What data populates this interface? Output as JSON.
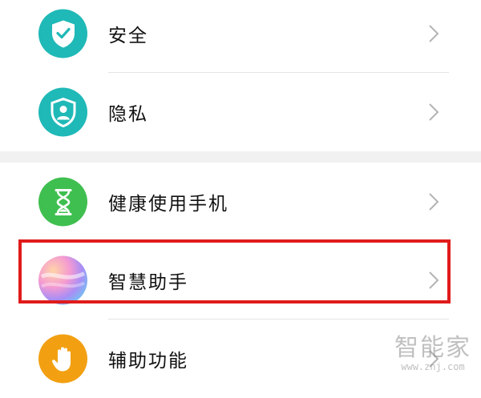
{
  "settings": {
    "items": [
      {
        "label": "安全",
        "icon": "shield-check-icon",
        "color": "#1fb9b7"
      },
      {
        "label": "隐私",
        "icon": "shield-person-icon",
        "color": "#1fb9b7"
      },
      {
        "label": "健康使用手机",
        "icon": "hourglass-icon",
        "color": "#3fbf4f"
      },
      {
        "label": "智慧助手",
        "icon": "smart-assistant-icon",
        "color": "gradient"
      },
      {
        "label": "辅助功能",
        "icon": "hand-icon",
        "color": "#f2a012"
      }
    ]
  },
  "highlight": {
    "item": "智慧助手",
    "color": "#e01b1b"
  },
  "watermark": {
    "text": "智能家",
    "url": "www.znj.com"
  }
}
